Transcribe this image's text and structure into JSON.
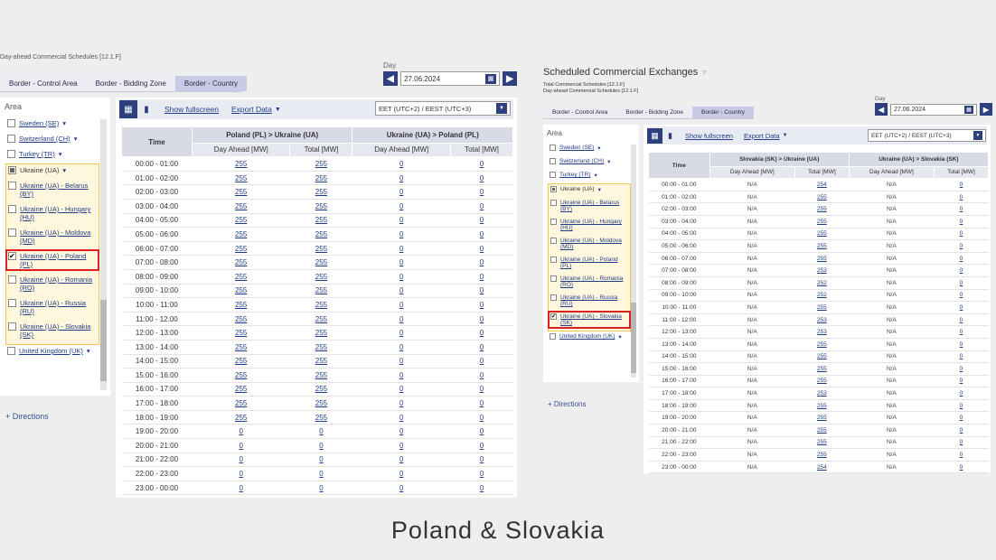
{
  "left": {
    "top_text": "Day-ahead Commercial Schedules [12.1.F]",
    "tabs": [
      "Border - Control Area",
      "Border - Bidding Zone",
      "Border - Country"
    ],
    "active_tab": 2,
    "day_label": "Day",
    "date": "27.06.2024",
    "area_title": "Area",
    "area_items": [
      {
        "label": "Sweden (SE)",
        "chev": true,
        "checked": false
      },
      {
        "label": "Switzerland (CH)",
        "chev": true,
        "checked": false
      },
      {
        "label": "Turkey (TR)",
        "chev": true,
        "checked": false
      },
      {
        "label": "Ukraine (UA)",
        "chev": true,
        "group_head": true,
        "checked": "partial"
      },
      {
        "label": "Ukraine (UA) - Belarus (BY)",
        "sub": true,
        "checked": false
      },
      {
        "label": "Ukraine (UA) - Hungary (HU)",
        "sub": true,
        "checked": false
      },
      {
        "label": "Ukraine (UA) - Moldova (MD)",
        "sub": true,
        "checked": false
      },
      {
        "label": "Ukraine (UA) - Poland (PL)",
        "sub": true,
        "checked": true,
        "highlight": true
      },
      {
        "label": "Ukraine (UA) - Romania (RO)",
        "sub": true,
        "checked": false
      },
      {
        "label": "Ukraine (UA) - Russia (RU)",
        "sub": true,
        "checked": false
      },
      {
        "label": "Ukraine (UA) - Slovakia (SK)",
        "sub": true,
        "checked": false
      },
      {
        "label": "United Kingdom (UK)",
        "chev": true,
        "checked": false
      }
    ],
    "directions": "Directions",
    "show_fullscreen": "Show fullscreen",
    "export_data": "Export Data",
    "timezone": "EET (UTC+2) / EEST (UTC+3)",
    "table": {
      "time_header": "Time",
      "group1": "Poland (PL) > Ukraine (UA)",
      "group2": "Ukraine (UA) > Poland (PL)",
      "sub": [
        "Day Ahead [MW]",
        "Total [MW]",
        "Day Ahead [MW]",
        "Total [MW]"
      ],
      "rows": [
        [
          "00:00 - 01:00",
          "255",
          "255",
          "0",
          "0"
        ],
        [
          "01:00 - 02:00",
          "255",
          "255",
          "0",
          "0"
        ],
        [
          "02:00 - 03:00",
          "255",
          "255",
          "0",
          "0"
        ],
        [
          "03:00 - 04:00",
          "255",
          "255",
          "0",
          "0"
        ],
        [
          "04:00 - 05:00",
          "255",
          "255",
          "0",
          "0"
        ],
        [
          "05:00 - 06:00",
          "255",
          "255",
          "0",
          "0"
        ],
        [
          "06:00 - 07:00",
          "255",
          "255",
          "0",
          "0"
        ],
        [
          "07:00 - 08:00",
          "255",
          "255",
          "0",
          "0"
        ],
        [
          "08:00 - 09:00",
          "255",
          "255",
          "0",
          "0"
        ],
        [
          "09:00 - 10:00",
          "255",
          "255",
          "0",
          "0"
        ],
        [
          "10:00 - 11:00",
          "255",
          "255",
          "0",
          "0"
        ],
        [
          "11:00 - 12:00",
          "255",
          "255",
          "0",
          "0"
        ],
        [
          "12:00 - 13:00",
          "255",
          "255",
          "0",
          "0"
        ],
        [
          "13:00 - 14:00",
          "255",
          "255",
          "0",
          "0"
        ],
        [
          "14:00 - 15:00",
          "255",
          "255",
          "0",
          "0"
        ],
        [
          "15:00 - 16:00",
          "255",
          "255",
          "0",
          "0"
        ],
        [
          "16:00 - 17:00",
          "255",
          "255",
          "0",
          "0"
        ],
        [
          "17:00 - 18:00",
          "255",
          "255",
          "0",
          "0"
        ],
        [
          "18:00 - 19:00",
          "255",
          "255",
          "0",
          "0"
        ],
        [
          "19:00 - 20:00",
          "0",
          "0",
          "0",
          "0"
        ],
        [
          "20:00 - 21:00",
          "0",
          "0",
          "0",
          "0"
        ],
        [
          "21:00 - 22:00",
          "0",
          "0",
          "0",
          "0"
        ],
        [
          "22:00 - 23:00",
          "0",
          "0",
          "0",
          "0"
        ],
        [
          "23:00 - 00:00",
          "0",
          "0",
          "0",
          "0"
        ]
      ]
    }
  },
  "right": {
    "title": "Scheduled Commercial Exchanges",
    "subtitle1": "Total Commercial Schedules [12.1.F]",
    "subtitle2": "Day-ahead Commercial Schedules [12.1.F]",
    "tabs": [
      "Border - Control Area",
      "Border - Bidding Zone",
      "Border - Country"
    ],
    "active_tab": 2,
    "day_label": "Day",
    "date": "27.06.2024",
    "area_title": "Area",
    "area_items": [
      {
        "label": "Sweden (SE)",
        "chev": true,
        "checked": false
      },
      {
        "label": "Switzerland (CH)",
        "chev": true,
        "checked": false
      },
      {
        "label": "Turkey (TR)",
        "chev": true,
        "checked": false
      },
      {
        "label": "Ukraine (UA)",
        "chev": true,
        "group_head": true,
        "checked": "partial"
      },
      {
        "label": "Ukraine (UA) - Belarus (BY)",
        "sub": true,
        "checked": false
      },
      {
        "label": "Ukraine (UA) - Hungary (HU)",
        "sub": true,
        "checked": false
      },
      {
        "label": "Ukraine (UA) - Moldova (MD)",
        "sub": true,
        "checked": false
      },
      {
        "label": "Ukraine (UA) - Poland (PL)",
        "sub": true,
        "checked": false
      },
      {
        "label": "Ukraine (UA) - Romania (RO)",
        "sub": true,
        "checked": false
      },
      {
        "label": "Ukraine (UA) - Russia (RU)",
        "sub": true,
        "checked": false
      },
      {
        "label": "Ukraine (UA) - Slovakia (SK)",
        "sub": true,
        "checked": true,
        "highlight": true
      },
      {
        "label": "United Kingdom (UK)",
        "chev": true,
        "checked": false
      }
    ],
    "directions": "Directions",
    "show_fullscreen": "Show fullscreen",
    "export_data": "Export Data",
    "timezone": "EET (UTC+2) / EEST (UTC+3)",
    "table": {
      "time_header": "Time",
      "group1": "Slovakia (SK) > Ukraine (UA)",
      "group2": "Ukraine (UA) > Slovakia (SK)",
      "sub": [
        "Day Ahead [MW]",
        "Total [MW]",
        "Day Ahead [MW]",
        "Total [MW]"
      ],
      "rows": [
        [
          "00:00 - 01:00",
          "N/A",
          "254",
          "N/A",
          "0"
        ],
        [
          "01:00 - 02:00",
          "N/A",
          "255",
          "N/A",
          "0"
        ],
        [
          "02:00 - 03:00",
          "N/A",
          "255",
          "N/A",
          "0"
        ],
        [
          "03:00 - 04:00",
          "N/A",
          "255",
          "N/A",
          "0"
        ],
        [
          "04:00 - 05:00",
          "N/A",
          "255",
          "N/A",
          "0"
        ],
        [
          "05:00 - 06:00",
          "N/A",
          "255",
          "N/A",
          "0"
        ],
        [
          "06:00 - 07:00",
          "N/A",
          "255",
          "N/A",
          "0"
        ],
        [
          "07:00 - 08:00",
          "N/A",
          "253",
          "N/A",
          "0"
        ],
        [
          "08:00 - 09:00",
          "N/A",
          "252",
          "N/A",
          "0"
        ],
        [
          "09:00 - 10:00",
          "N/A",
          "252",
          "N/A",
          "0"
        ],
        [
          "10:00 - 11:00",
          "N/A",
          "255",
          "N/A",
          "0"
        ],
        [
          "11:00 - 12:00",
          "N/A",
          "253",
          "N/A",
          "0"
        ],
        [
          "12:00 - 13:00",
          "N/A",
          "253",
          "N/A",
          "0"
        ],
        [
          "13:00 - 14:00",
          "N/A",
          "255",
          "N/A",
          "0"
        ],
        [
          "14:00 - 15:00",
          "N/A",
          "255",
          "N/A",
          "0"
        ],
        [
          "15:00 - 16:00",
          "N/A",
          "255",
          "N/A",
          "0"
        ],
        [
          "16:00 - 17:00",
          "N/A",
          "255",
          "N/A",
          "0"
        ],
        [
          "17:00 - 18:00",
          "N/A",
          "253",
          "N/A",
          "0"
        ],
        [
          "18:00 - 19:00",
          "N/A",
          "255",
          "N/A",
          "0"
        ],
        [
          "19:00 - 20:00",
          "N/A",
          "255",
          "N/A",
          "0"
        ],
        [
          "20:00 - 21:00",
          "N/A",
          "255",
          "N/A",
          "0"
        ],
        [
          "21:00 - 22:00",
          "N/A",
          "255",
          "N/A",
          "0"
        ],
        [
          "22:00 - 23:00",
          "N/A",
          "255",
          "N/A",
          "0"
        ],
        [
          "23:00 - 00:00",
          "N/A",
          "254",
          "N/A",
          "0"
        ]
      ]
    }
  },
  "caption": "Poland & Slovakia"
}
